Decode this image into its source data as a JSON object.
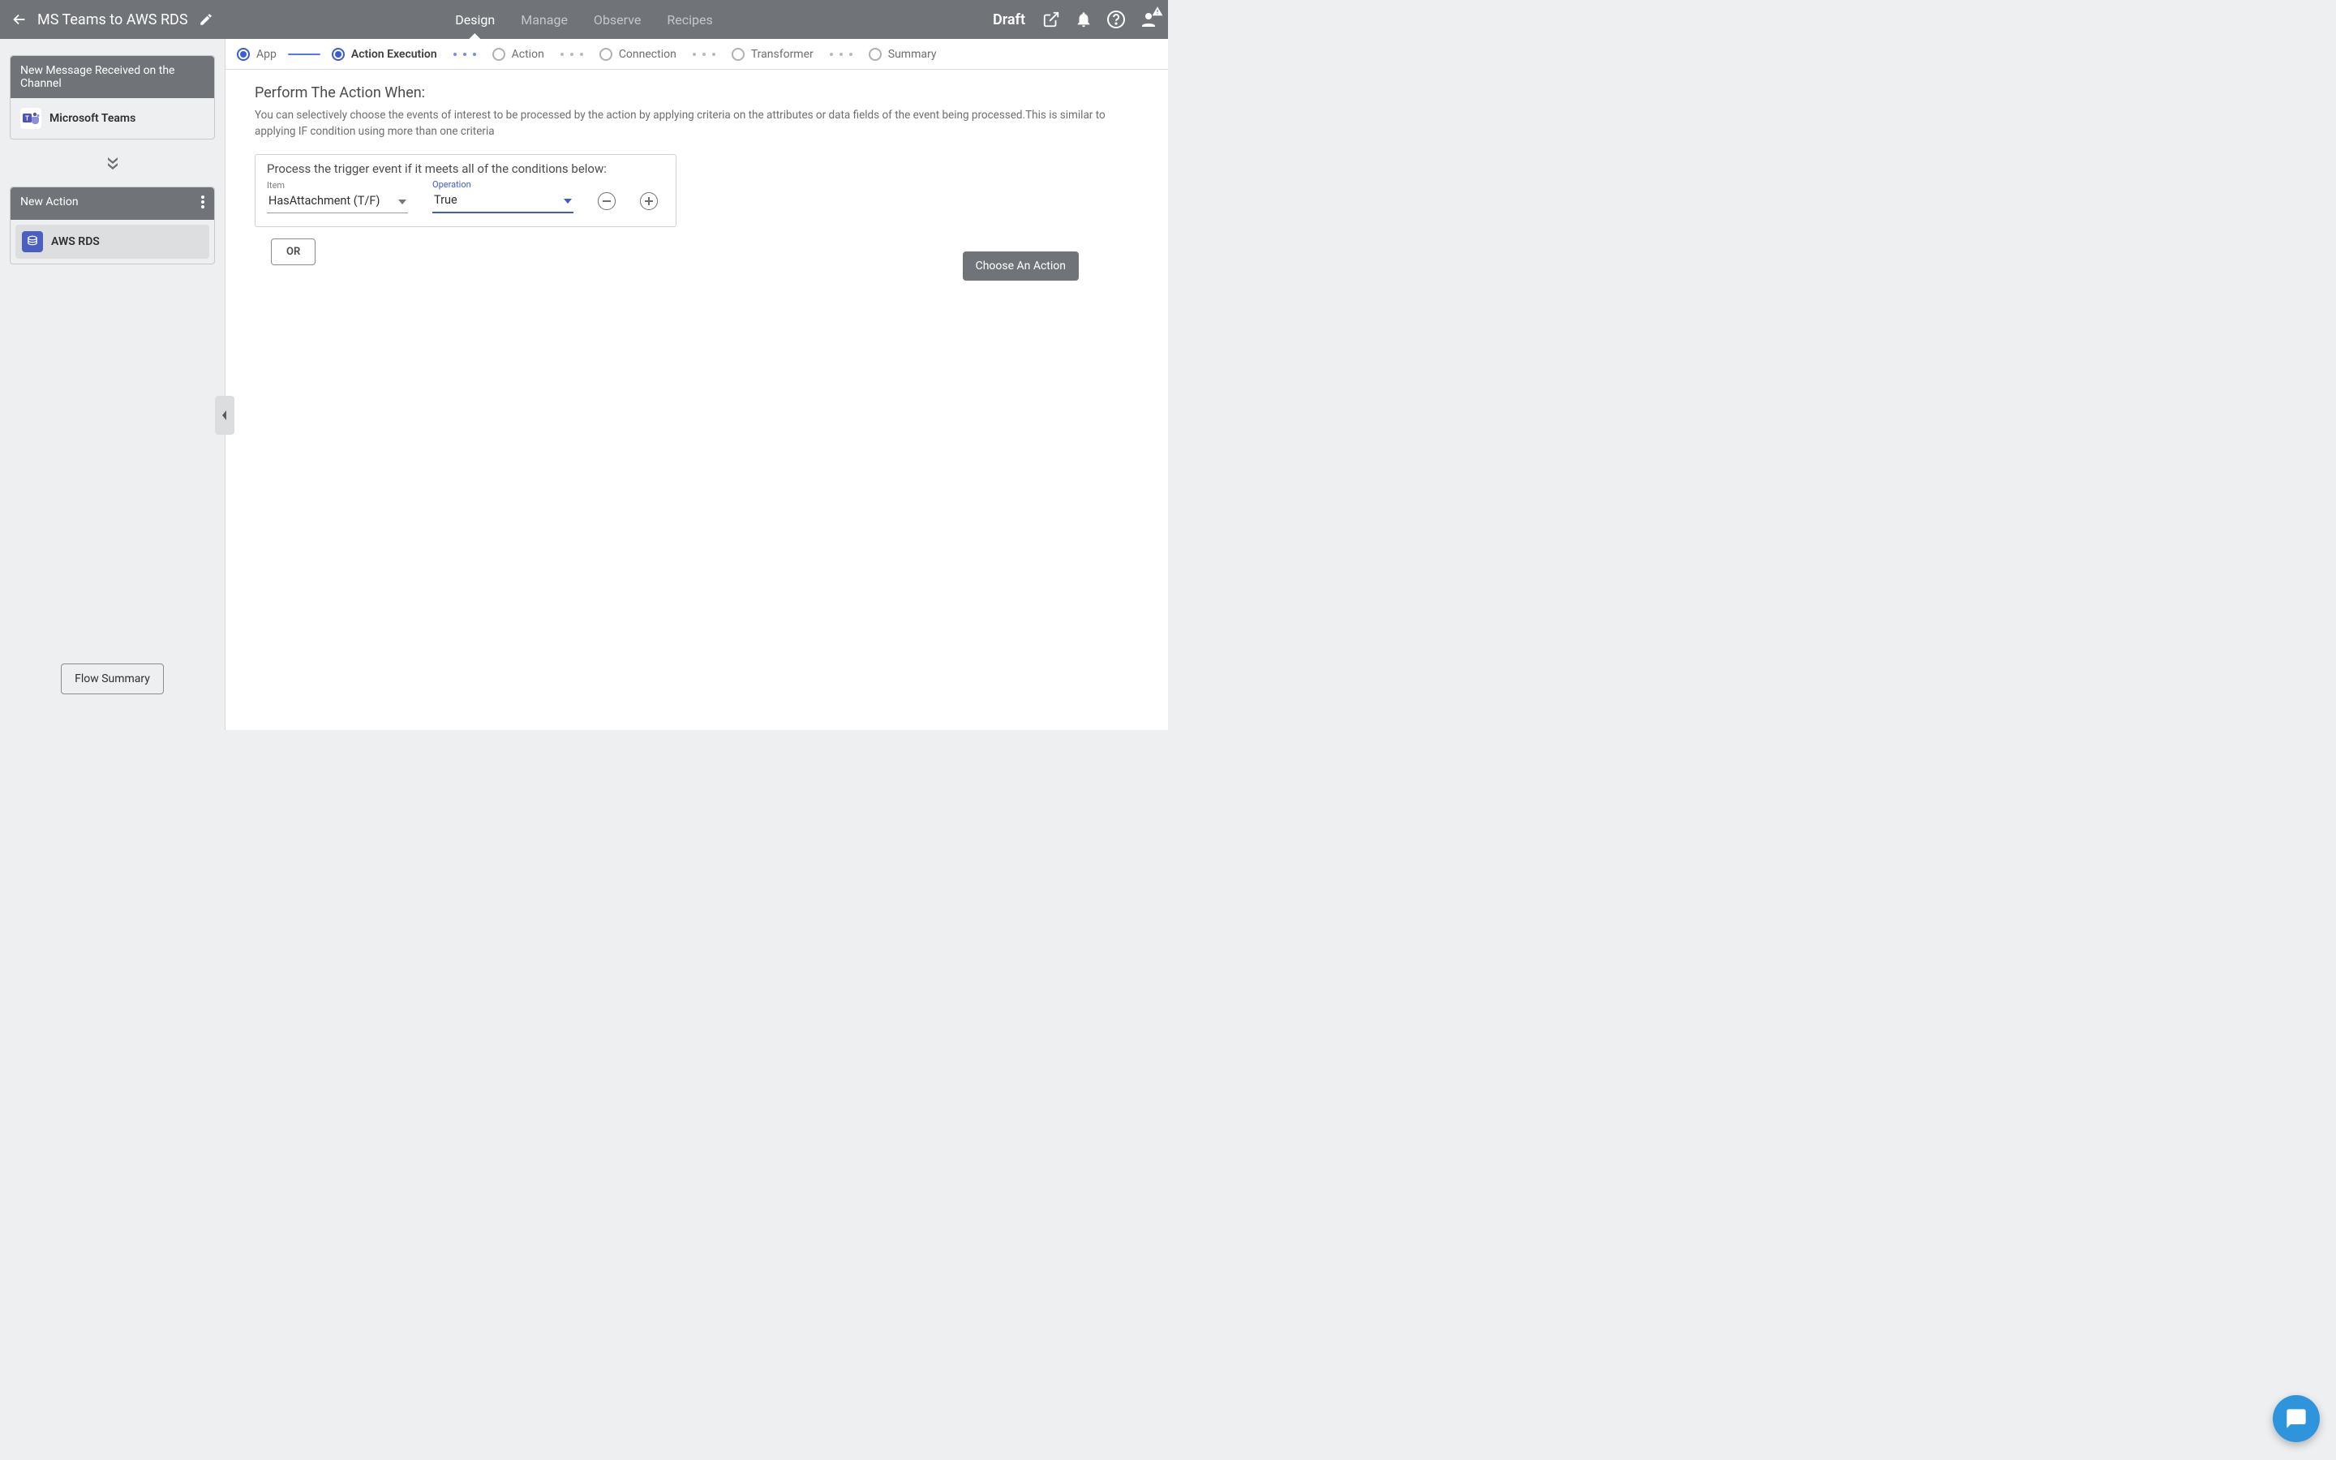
{
  "header": {
    "title": "MS Teams to AWS RDS",
    "status": "Draft",
    "tabs": [
      {
        "label": "Design",
        "active": true
      },
      {
        "label": "Manage",
        "active": false
      },
      {
        "label": "Observe",
        "active": false
      },
      {
        "label": "Recipes",
        "active": false
      }
    ]
  },
  "sidebar": {
    "trigger": {
      "title": "New Message Received on the Channel",
      "app_label": "Microsoft Teams"
    },
    "action": {
      "title": "New Action",
      "app_label": "AWS RDS"
    },
    "flow_summary_label": "Flow Summary"
  },
  "steps": [
    {
      "label": "App",
      "state": "done"
    },
    {
      "label": "Action Execution",
      "state": "active"
    },
    {
      "label": "Action",
      "state": "pending"
    },
    {
      "label": "Connection",
      "state": "pending"
    },
    {
      "label": "Transformer",
      "state": "pending"
    },
    {
      "label": "Summary",
      "state": "pending"
    }
  ],
  "content": {
    "heading": "Perform The Action When:",
    "description": "You can selectively choose the events of interest to be processed by the action by applying criteria on the attributes or data fields of the event being processed.This is similar to applying IF condition using more than one criteria",
    "condition_box_title": "Process the trigger event if it meets all of the conditions below:",
    "item_label": "Item",
    "operation_label": "Operation",
    "item_value": "HasAttachment (T/F)",
    "operation_value": "True",
    "or_label": "OR",
    "choose_action_label": "Choose An Action"
  }
}
